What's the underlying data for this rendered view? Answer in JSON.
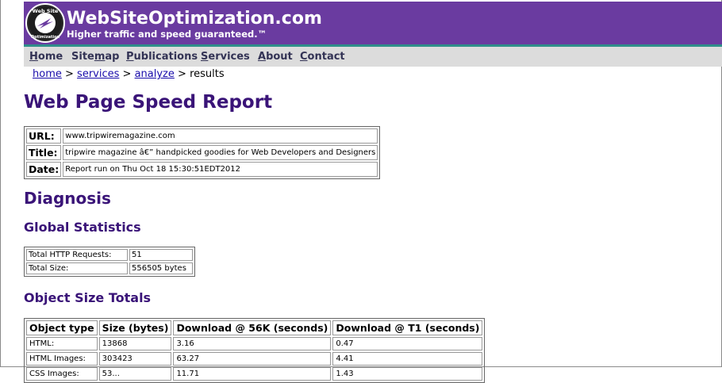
{
  "header": {
    "site_name": "WebSiteOptimization.com",
    "tagline": "Higher traffic and speed guaranteed.™",
    "logo_text_top": "Web Site",
    "logo_text_bottom": "Optimization",
    "colors": {
      "header_bg": "#6a3ba0",
      "accent": "#2f8f8a",
      "heading": "#3a1478"
    }
  },
  "nav": {
    "items": [
      {
        "label": "Home",
        "access_key": "H"
      },
      {
        "label": "Sitemap",
        "access_key": "m"
      },
      {
        "label": "Publications",
        "access_key": "P"
      },
      {
        "label": "Services",
        "access_key": "S"
      },
      {
        "label": "About",
        "access_key": "A"
      },
      {
        "label": "Contact",
        "access_key": "C"
      }
    ]
  },
  "breadcrumb": {
    "home": "home",
    "services": "services",
    "analyze": "analyze",
    "current": "results",
    "separator": ">"
  },
  "page_title": "Web Page Speed Report",
  "report_info": {
    "url_label": "URL:",
    "url_value": "www.tripwiremagazine.com",
    "title_label": "Title:",
    "title_value": "tripwire magazine â€” handpicked goodies for Web Developers and Designers",
    "date_label": "Date:",
    "date_value": "Report run on Thu Oct 18 15:30:51EDT2012"
  },
  "diagnosis_heading": "Diagnosis",
  "global_stats": {
    "heading": "Global Statistics",
    "rows": [
      {
        "label": "Total HTTP Requests:",
        "value": "51"
      },
      {
        "label": "Total Size:",
        "value": "556505 bytes"
      }
    ]
  },
  "object_totals": {
    "heading": "Object Size Totals",
    "columns": [
      "Object type",
      "Size (bytes)",
      "Download @ 56K (seconds)",
      "Download @ T1 (seconds)"
    ],
    "rows": [
      [
        "HTML:",
        "13868",
        "3.16",
        "0.47"
      ],
      [
        "HTML Images:",
        "303423",
        "63.27",
        "4.41"
      ],
      [
        "CSS Images:",
        "53... ",
        "11.71",
        "1.43"
      ]
    ]
  }
}
